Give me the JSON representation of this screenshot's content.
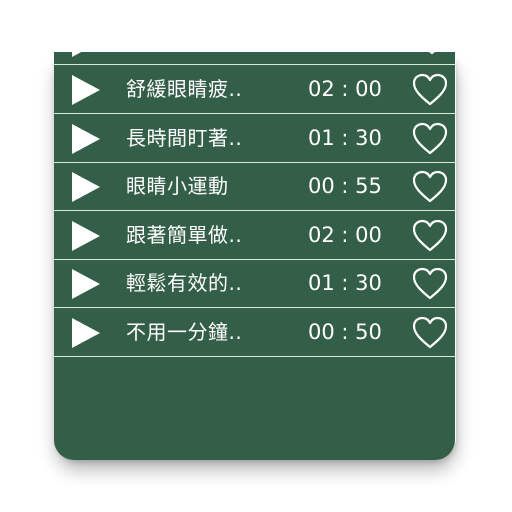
{
  "colors": {
    "panel_background": "#335e47",
    "divider": "#d9e6dd",
    "text": "#ffffff"
  },
  "icons": {
    "play": "play-icon",
    "favorite": "heart-outline-icon"
  },
  "tracks": [
    {
      "title": "舒緩眼睛疲..",
      "duration": "02 : 00"
    },
    {
      "title": "長時間盯著..",
      "duration": "01 : 30"
    },
    {
      "title": "眼睛小運動",
      "duration": "00 : 55"
    },
    {
      "title": "跟著簡單做..",
      "duration": "02 : 00"
    },
    {
      "title": "輕鬆有效的..",
      "duration": "01 : 30"
    },
    {
      "title": "不用一分鐘..",
      "duration": "00 : 50"
    }
  ]
}
